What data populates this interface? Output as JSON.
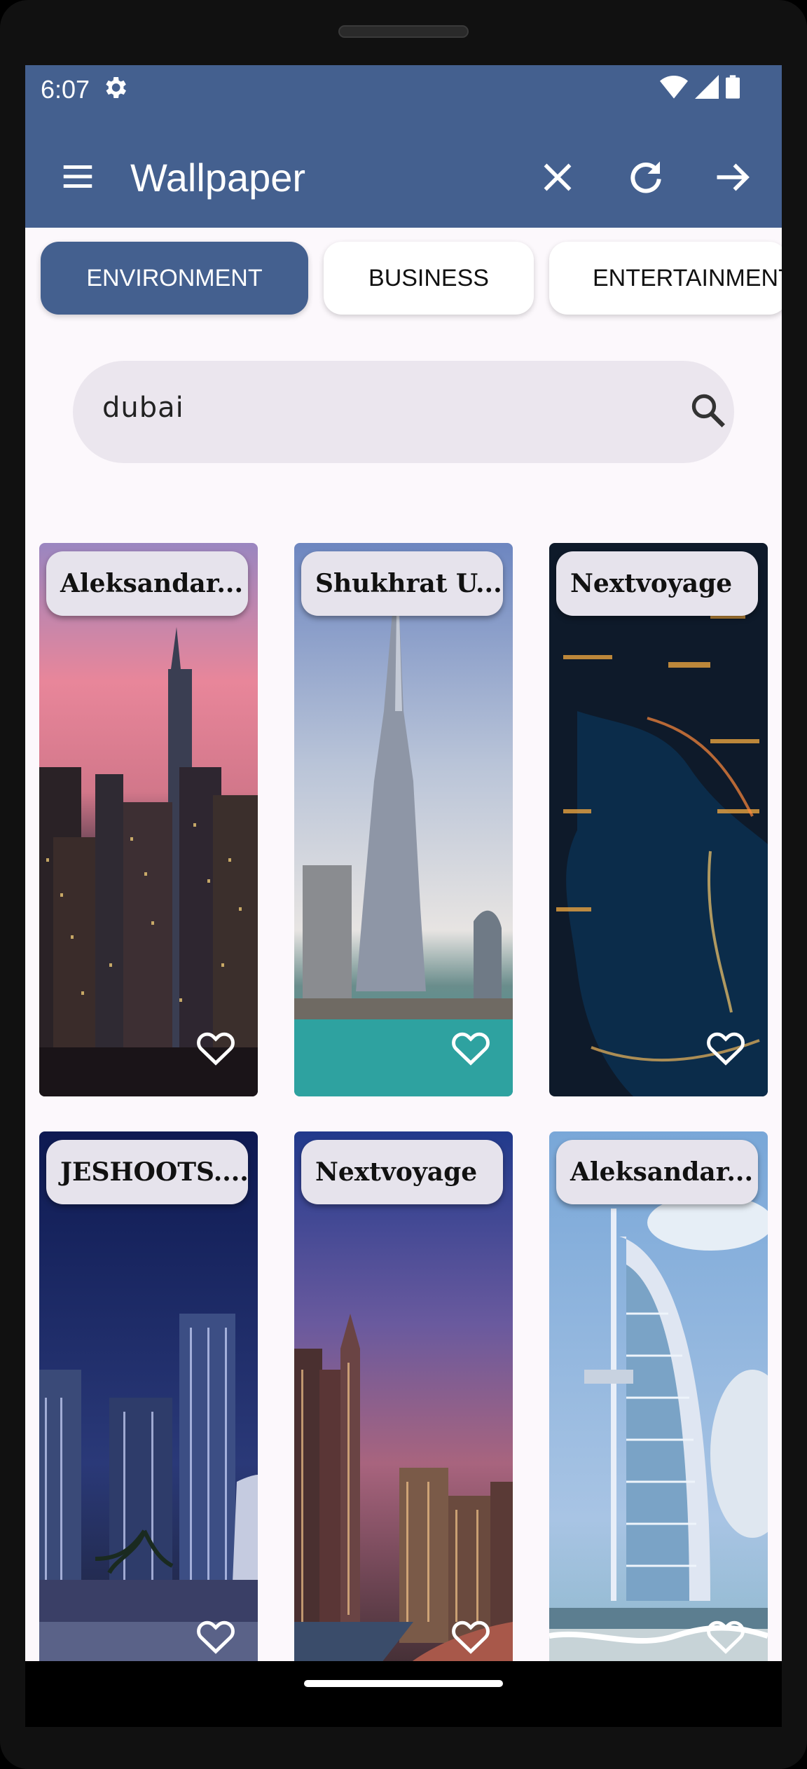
{
  "status": {
    "time": "6:07"
  },
  "appbar": {
    "title": "Wallpaper"
  },
  "categories": [
    "ENVIRONMENT",
    "BUSINESS",
    "ENTERTAINMENT"
  ],
  "search": {
    "value": "dubai"
  },
  "cards": [
    {
      "author": "Aleksandar..."
    },
    {
      "author": "Shukhrat U..."
    },
    {
      "author": "Nextvoyage"
    },
    {
      "author": "JESHOOTS...."
    },
    {
      "author": "Nextvoyage"
    },
    {
      "author": "Aleksandar..."
    }
  ],
  "colors": {
    "primary": "#44608f",
    "chip_bg": "#ffffff",
    "search_bg": "#ebe6ee",
    "screen_bg": "#fcf8fc"
  },
  "icons": [
    "menu-icon",
    "close-icon",
    "refresh-icon",
    "arrow-forward-icon",
    "search-icon",
    "heart-outline-icon",
    "settings-icon",
    "wifi-icon",
    "signal-icon",
    "battery-icon"
  ]
}
